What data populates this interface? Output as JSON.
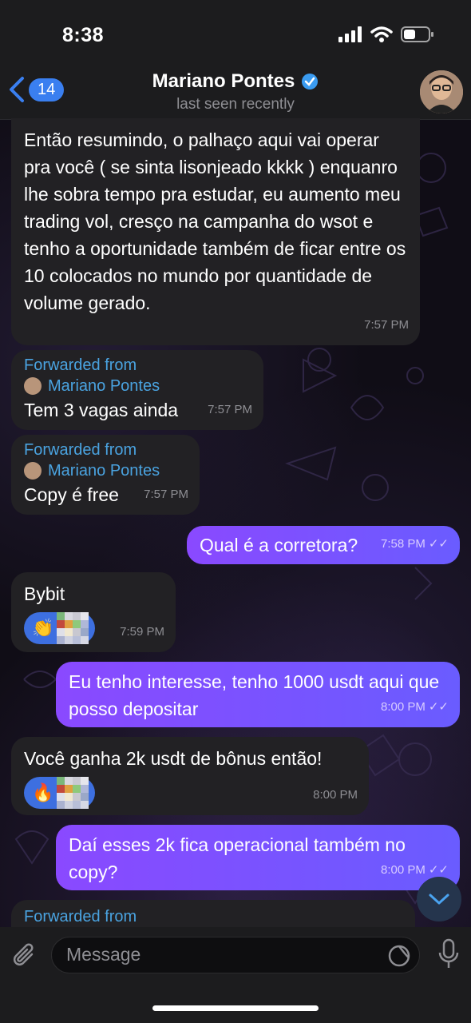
{
  "status": {
    "time": "8:38"
  },
  "header": {
    "back_count": "14",
    "name": "Mariano Pontes",
    "status": "last seen recently"
  },
  "messages": [
    {
      "type": "in",
      "text": "Então resumindo, o palhaço aqui vai operar pra você ( se sinta lisonjeado kkkk ) enquanro lhe sobra tempo pra estudar, eu aumento meu trading vol, cresço na campanha do wsot e tenho a oportunidade também de ficar entre os 10 colocados no mundo por quantidade de volume gerado.",
      "time": "7:57 PM"
    },
    {
      "type": "in",
      "forwarded_label": "Forwarded from",
      "forwarded_name": "Mariano Pontes",
      "text": "Tem 3 vagas ainda",
      "time": "7:57 PM"
    },
    {
      "type": "in",
      "forwarded_label": "Forwarded from",
      "forwarded_name": "Mariano Pontes",
      "text": "Copy é free",
      "time": "7:57 PM"
    },
    {
      "type": "out",
      "text": "Qual é a corretora?",
      "time": "7:58 PM"
    },
    {
      "type": "in",
      "text": "Bybit",
      "reaction": "👏",
      "time": "7:59 PM"
    },
    {
      "type": "out",
      "text": "Eu tenho interesse, tenho 1000 usdt aqui que posso depositar",
      "time": "8:00 PM"
    },
    {
      "type": "in",
      "text": "Você ganha 2k usdt de bônus então!",
      "reaction": "🔥",
      "time": "8:00 PM"
    },
    {
      "type": "out",
      "text": "Daí esses 2k fica operacional também no copy?",
      "time": "8:00 PM"
    },
    {
      "type": "in",
      "forwarded_label": "Forwarded from"
    }
  ],
  "input": {
    "placeholder": "Message"
  },
  "colors": {
    "accent": "#3a7ff0",
    "outgoing": "#7c4dff",
    "incoming": "#222124",
    "link": "#4aa3e0"
  }
}
